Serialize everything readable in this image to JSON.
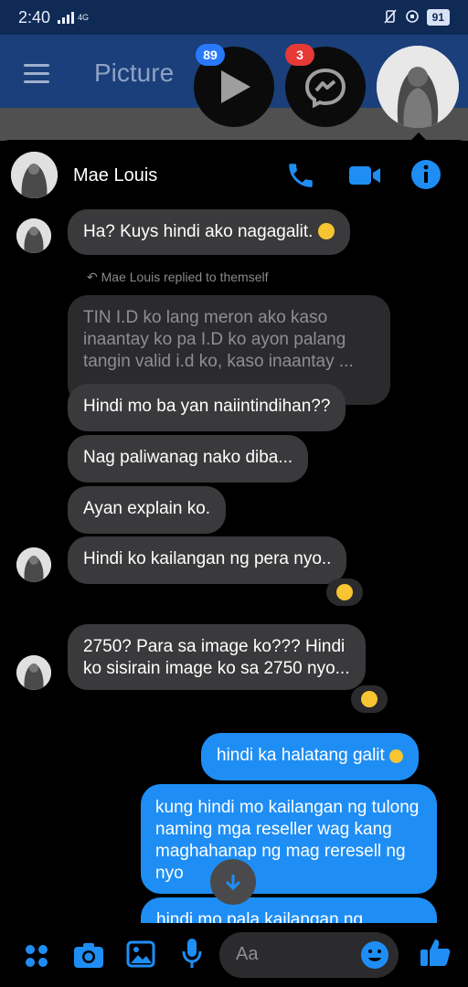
{
  "status_bar": {
    "time": "2:40",
    "network": "4G",
    "battery": "91"
  },
  "app_bar": {
    "title": "Picture"
  },
  "chat_heads": {
    "youtube_badge": "89",
    "messenger_badge": "3"
  },
  "chat": {
    "contact_name": "Mae Louis",
    "reply_note": "Mae Louis replied to themself",
    "messages": [
      {
        "direction": "in",
        "text": "Ha? Kuys hindi ako nagagalit."
      },
      {
        "direction": "in-quoted",
        "text": "TIN I.D ko lang meron ako kaso inaantay ko pa I.D ko ayon palang tangin valid i.d ko, kaso inaantay ..."
      },
      {
        "direction": "in",
        "text": "Hindi mo ba yan naiintindihan??"
      },
      {
        "direction": "in",
        "text": "Nag paliwanag nako diba..."
      },
      {
        "direction": "in",
        "text": "Ayan explain ko."
      },
      {
        "direction": "in",
        "text": "Hindi ko kailangan ng pera nyo.."
      },
      {
        "direction": "in",
        "text_line1": "2750? Para sa image ko??? Hindi",
        "text_line2": "ko sisirain image ko sa 2750 nyo..."
      },
      {
        "direction": "out",
        "text": "hindi ka halatang galit"
      },
      {
        "direction": "out",
        "text": "kung hindi mo kailangan ng tulong naming mga reseller wag kang maghahanap ng mag reresell ng nyo"
      },
      {
        "direction": "out",
        "text": "hindi mo pala kailangan ng"
      }
    ]
  },
  "composer": {
    "placeholder": "Aa"
  },
  "colors": {
    "accent": "#1e8ef5",
    "incoming_bubble": "#3a3a3c",
    "appbar": "#1a3f7a"
  }
}
